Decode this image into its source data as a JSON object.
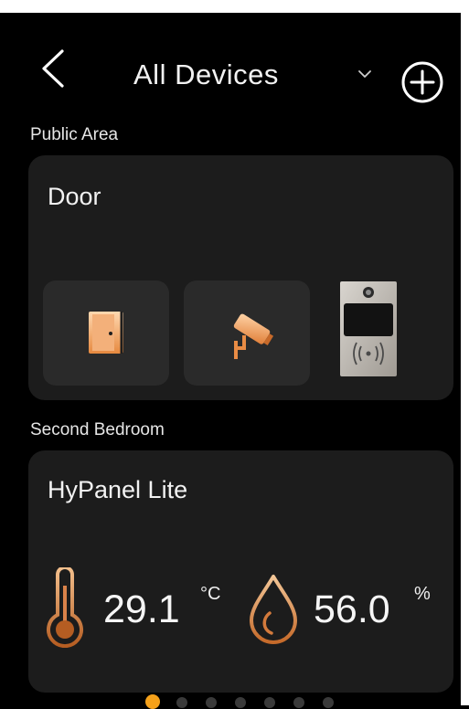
{
  "header": {
    "title": "All Devices",
    "back_icon": "chevron-left-icon",
    "dropdown_icon": "chevron-down-icon",
    "add_icon": "plus-circle-icon"
  },
  "sections": [
    {
      "label": "Public Area",
      "card": {
        "title": "Door",
        "tiles": [
          {
            "icon": "door-icon"
          },
          {
            "icon": "camera-icon"
          },
          {
            "icon": "intercom-icon"
          }
        ]
      }
    },
    {
      "label": "Second Bedroom",
      "card": {
        "title": "HyPanel Lite",
        "temperature": {
          "value": "29.1",
          "unit": "°C",
          "icon": "thermometer-icon"
        },
        "humidity": {
          "value": "56.0",
          "unit": "%",
          "icon": "water-drop-icon"
        }
      }
    }
  ],
  "pagination": {
    "count": 7,
    "active_index": 0
  },
  "colors": {
    "accent": "#F5A11A",
    "background": "#000000",
    "card": "#1C1C1C",
    "tile": "#2A2A2A"
  }
}
